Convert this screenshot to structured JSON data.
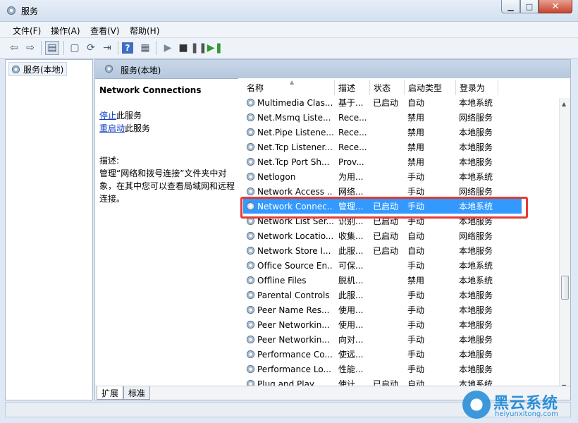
{
  "window": {
    "title": "服务"
  },
  "menu": [
    {
      "label": "文件(F)"
    },
    {
      "label": "操作(A)"
    },
    {
      "label": "查看(V)"
    },
    {
      "label": "帮助(H)"
    }
  ],
  "toolbar_icons": [
    "back-icon",
    "forward-icon",
    "console-tree-icon",
    "properties-icon",
    "refresh-icon",
    "export-icon",
    "help-icon",
    "action-pane-icon",
    "start-icon",
    "stop-icon",
    "pause-icon",
    "restart-icon"
  ],
  "tree": {
    "root": "服务(本地)"
  },
  "pane_header": "服务(本地)",
  "details": {
    "service_name": "Network Connections",
    "stop_link": "停止",
    "stop_suffix": "此服务",
    "restart_link": "重启动",
    "restart_suffix": "此服务",
    "desc_label": "描述:",
    "desc_text": "管理“网络和拨号连接”文件夹中对象，在其中您可以查看局域网和远程连接。"
  },
  "columns": {
    "name": "名称",
    "desc": "描述",
    "status": "状态",
    "startup": "启动类型",
    "logon": "登录为"
  },
  "services": [
    {
      "name": "Multimedia Clas...",
      "desc": "基于...",
      "status": "已启动",
      "startup": "自动",
      "logon": "本地系统"
    },
    {
      "name": "Net.Msmq Liste...",
      "desc": "Rece...",
      "status": "",
      "startup": "禁用",
      "logon": "网络服务"
    },
    {
      "name": "Net.Pipe Listene...",
      "desc": "Rece...",
      "status": "",
      "startup": "禁用",
      "logon": "本地服务"
    },
    {
      "name": "Net.Tcp Listener...",
      "desc": "Rece...",
      "status": "",
      "startup": "禁用",
      "logon": "本地服务"
    },
    {
      "name": "Net.Tcp Port Sh...",
      "desc": "Prov...",
      "status": "",
      "startup": "禁用",
      "logon": "本地服务"
    },
    {
      "name": "Netlogon",
      "desc": "为用...",
      "status": "",
      "startup": "手动",
      "logon": "本地系统"
    },
    {
      "name": "Network Access ...",
      "desc": "网络...",
      "status": "",
      "startup": "手动",
      "logon": "网络服务"
    },
    {
      "name": "Network Connec...",
      "desc": "管理...",
      "status": "已启动",
      "startup": "手动",
      "logon": "本地系统",
      "selected": true
    },
    {
      "name": "Network List Ser...",
      "desc": "识别...",
      "status": "已启动",
      "startup": "手动",
      "logon": "本地服务"
    },
    {
      "name": "Network Locatio...",
      "desc": "收集...",
      "status": "已启动",
      "startup": "自动",
      "logon": "网络服务"
    },
    {
      "name": "Network Store I...",
      "desc": "此服...",
      "status": "已启动",
      "startup": "自动",
      "logon": "本地服务"
    },
    {
      "name": "Office Source En...",
      "desc": "可保...",
      "status": "",
      "startup": "手动",
      "logon": "本地系统"
    },
    {
      "name": "Offline Files",
      "desc": "脱机...",
      "status": "",
      "startup": "禁用",
      "logon": "本地系统"
    },
    {
      "name": "Parental Controls",
      "desc": "此服...",
      "status": "",
      "startup": "手动",
      "logon": "本地服务"
    },
    {
      "name": "Peer Name Res...",
      "desc": "使用...",
      "status": "",
      "startup": "手动",
      "logon": "本地服务"
    },
    {
      "name": "Peer Networkin...",
      "desc": "使用...",
      "status": "",
      "startup": "手动",
      "logon": "本地服务"
    },
    {
      "name": "Peer Networkin...",
      "desc": "向对...",
      "status": "",
      "startup": "手动",
      "logon": "本地服务"
    },
    {
      "name": "Performance Co...",
      "desc": "使远...",
      "status": "",
      "startup": "手动",
      "logon": "本地服务"
    },
    {
      "name": "Performance Lo...",
      "desc": "性能...",
      "status": "",
      "startup": "手动",
      "logon": "本地服务"
    },
    {
      "name": "Plug and Play",
      "desc": "使计...",
      "status": "已启动",
      "startup": "自动",
      "logon": "本地系统"
    }
  ],
  "tabs": [
    {
      "label": "扩展"
    },
    {
      "label": "标准"
    }
  ],
  "watermark": {
    "brand": "黑云系统",
    "url": "heiyunxitong.com"
  },
  "colors": {
    "selection": "#3399ff",
    "highlight_box": "#e53a35",
    "link": "#1340c4"
  }
}
